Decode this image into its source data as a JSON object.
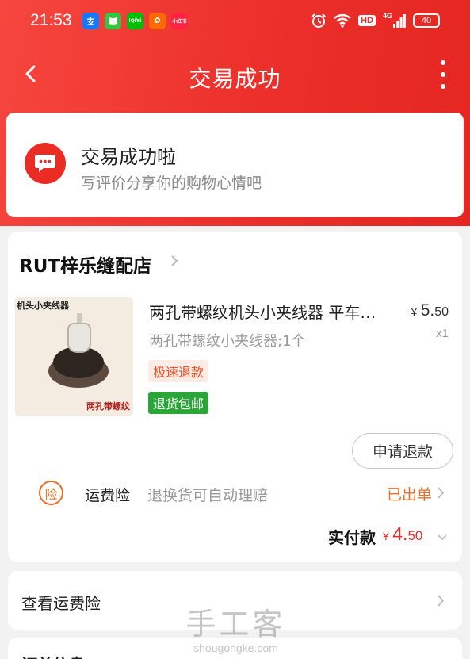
{
  "status_bar": {
    "time": "21:53",
    "network_label": "4G",
    "hd_label": "HD",
    "battery": "40",
    "apps": [
      {
        "name": "alipay-icon",
        "glyph": "支",
        "color": "#1677ff"
      },
      {
        "name": "reader-icon",
        "glyph": "📖",
        "color": "#37c23f"
      },
      {
        "name": "iqiyi-icon",
        "glyph": "iQIYI",
        "color": "#00be06"
      },
      {
        "name": "app-grid-icon",
        "glyph": "✿",
        "color": "#ff6a00"
      },
      {
        "name": "xiaohongshu-icon",
        "glyph": "小红书",
        "color": "#ff2442"
      }
    ]
  },
  "nav": {
    "title": "交易成功"
  },
  "success": {
    "title": "交易成功啦",
    "subtitle": "写评价分享你的购物心情吧"
  },
  "order": {
    "shop_name": "RUT梓乐缝配店",
    "product": {
      "image_text_top": "机头小夹线器",
      "image_text_bottom": "两孔带螺纹",
      "title": "两孔带螺纹机头小夹线器 平车…",
      "sku": "两孔带螺纹小夹线器;1个",
      "price_symbol": "¥",
      "price_int": "5.",
      "price_dec": "50",
      "qty": "x1",
      "tag_fast": "极速退款",
      "tag_return": "退货包邮"
    },
    "refund_button": "申请退款",
    "insurance": {
      "icon_glyph": "险",
      "label": "运费险",
      "description": "退换货可自动理赔",
      "status": "已出单"
    },
    "paid": {
      "label": "实付款",
      "symbol": "¥",
      "int": "4.",
      "dec": "50"
    }
  },
  "freight": {
    "label": "查看运费险"
  },
  "order_info": {
    "label": "订单信息"
  },
  "watermark": {
    "main": "手工客",
    "sub": "shougongke.com"
  },
  "colors": {
    "brand_red": "#ec2f2a",
    "accent_orange": "#e8702a",
    "price_red": "#e8302b",
    "tag_green": "#2aa638"
  }
}
